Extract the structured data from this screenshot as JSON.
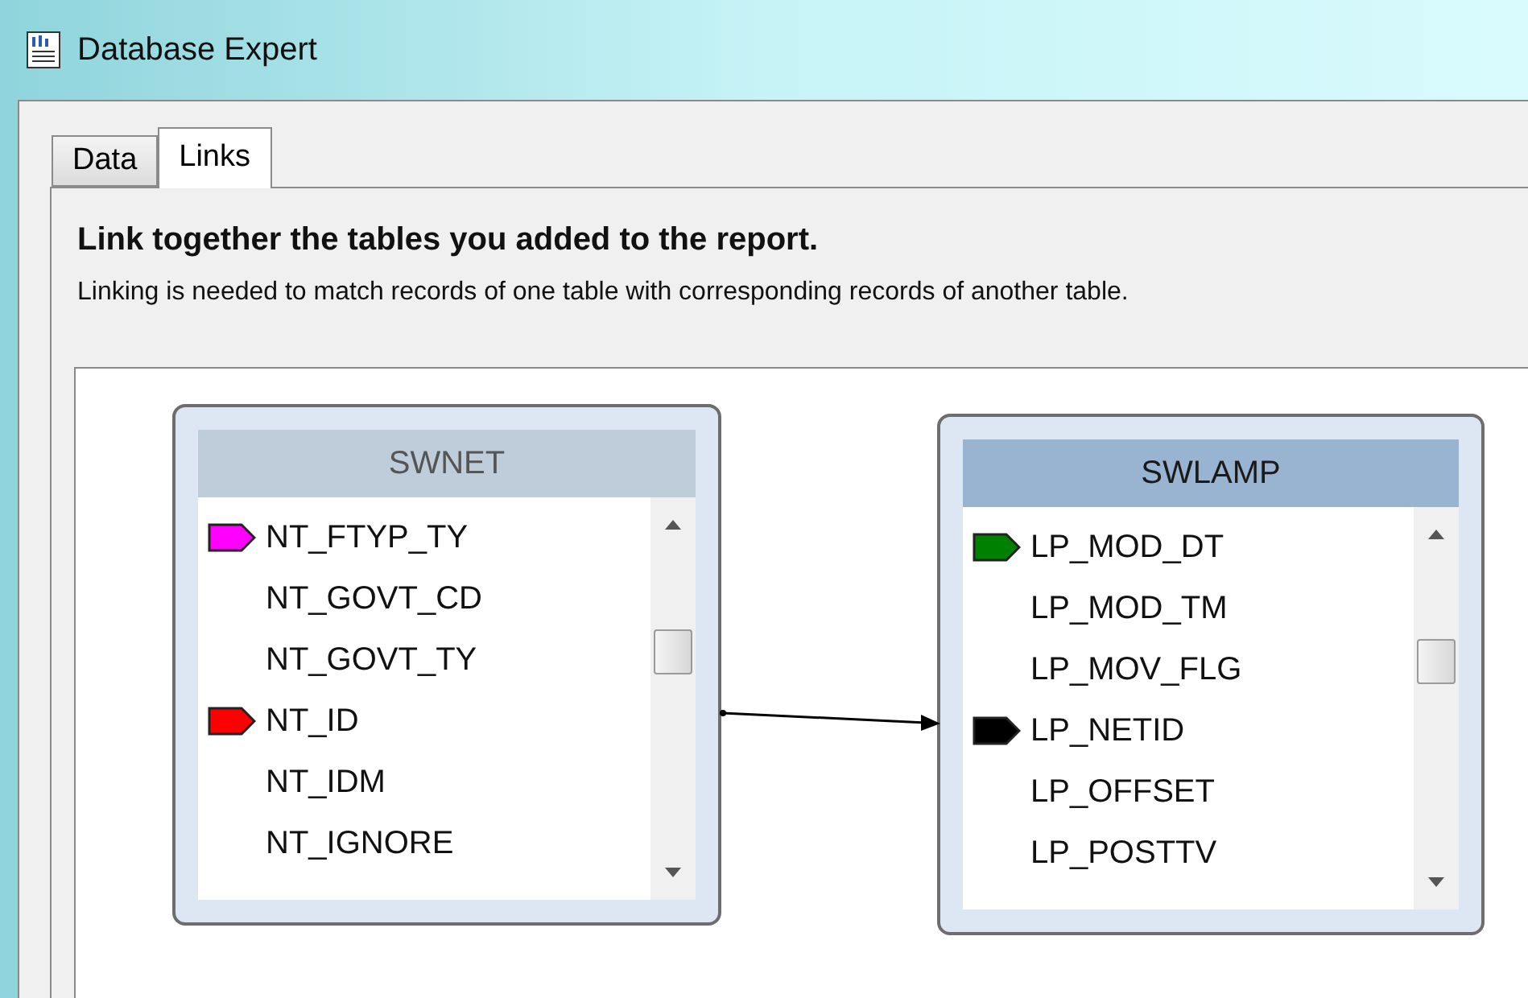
{
  "window": {
    "title": "Database Expert"
  },
  "tabs": [
    {
      "label": "Data",
      "selected": false
    },
    {
      "label": "Links",
      "selected": true
    }
  ],
  "heading": "Link together the tables you added to the report.",
  "description": "Linking is needed to match records of one table with corresponding records of another table.",
  "tables": [
    {
      "name": "SWNET",
      "selected": false,
      "fields": [
        {
          "name": "NT_FTYP_TY",
          "color": "#ff00ff"
        },
        {
          "name": "NT_GOVT_CD"
        },
        {
          "name": "NT_GOVT_TY"
        },
        {
          "name": "NT_ID",
          "color": "#ff0000"
        },
        {
          "name": "NT_IDM"
        },
        {
          "name": "NT_IGNORE"
        }
      ]
    },
    {
      "name": "SWLAMP",
      "selected": true,
      "fields": [
        {
          "name": "LP_MOD_DT",
          "color": "#008000"
        },
        {
          "name": "LP_MOD_TM"
        },
        {
          "name": "LP_MOV_FLG"
        },
        {
          "name": "LP_NETID",
          "color": "#000000"
        },
        {
          "name": "LP_OFFSET"
        },
        {
          "name": "LP_POSTTV"
        }
      ]
    }
  ]
}
